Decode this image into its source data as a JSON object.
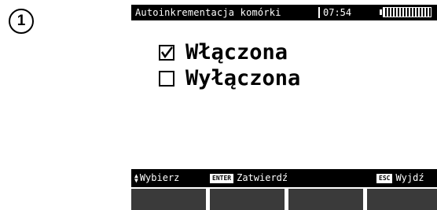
{
  "step_number": "1",
  "device": {
    "title": "Autoinkrementacja komórki",
    "clock": "07:54",
    "battery_icon": "battery-icon",
    "options": [
      {
        "label": "Włączona",
        "checked": true
      },
      {
        "label": "Wyłączona",
        "checked": false
      }
    ],
    "statusbar": {
      "select_label": "Wybierz",
      "enter_key": "ENTER",
      "confirm_label": "Zatwierdź",
      "esc_key": "ESC",
      "exit_label": "Wyjdź"
    },
    "colors": {
      "screen_bg": "#ffffff",
      "bar_bg": "#000000",
      "softkey": "#3a3a3a"
    }
  }
}
